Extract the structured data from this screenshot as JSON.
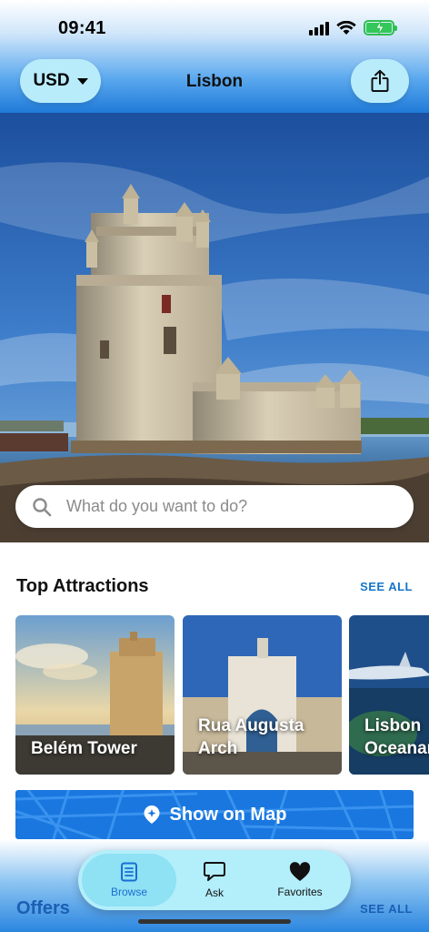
{
  "status_bar": {
    "time": "09:41"
  },
  "header": {
    "currency": "USD",
    "city": "Lisbon"
  },
  "search": {
    "placeholder": "What do you want to do?"
  },
  "top_attractions": {
    "title": "Top Attractions",
    "see_all": "SEE ALL",
    "items": [
      {
        "label": "Belém Tower"
      },
      {
        "label": "Rua Augusta Arch"
      },
      {
        "label": "Lisbon Oceanarium"
      }
    ]
  },
  "map_button": {
    "label": "Show on Map"
  },
  "offers": {
    "title": "Offers",
    "see_all": "SEE ALL"
  },
  "tabbar": {
    "tabs": [
      {
        "label": "Browse"
      },
      {
        "label": "Ask"
      },
      {
        "label": "Favorites"
      }
    ]
  },
  "colors": {
    "accent": "#1576c9",
    "map_blue": "#1977df",
    "pill": "#b9ecfb",
    "tab_active": "#8fe1f4"
  }
}
